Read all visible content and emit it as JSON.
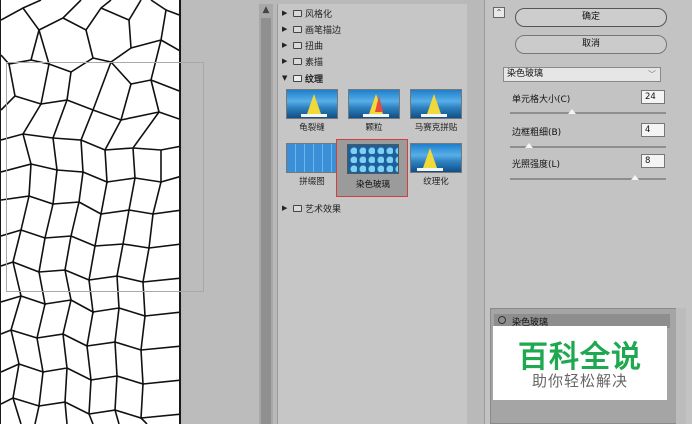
{
  "gallery": {
    "folders_top": [
      {
        "label": "风格化"
      },
      {
        "label": "画笔描边"
      },
      {
        "label": "扭曲"
      },
      {
        "label": "素描"
      }
    ],
    "open_folder": {
      "label": "纹理"
    },
    "thumbnails": [
      {
        "label": "龟裂缝"
      },
      {
        "label": "颗粒"
      },
      {
        "label": "马赛克拼贴"
      },
      {
        "label": "拼缀图"
      },
      {
        "label": "染色玻璃"
      },
      {
        "label": "纹理化"
      }
    ],
    "folders_bottom": [
      {
        "label": "艺术效果"
      }
    ]
  },
  "settings": {
    "collapse_icon": "collapse-up-icon",
    "ok_label": "确定",
    "cancel_label": "取消",
    "filter_selected": "染色玻璃",
    "params": [
      {
        "label": "单元格大小(C)",
        "value": "24",
        "level": 0.4
      },
      {
        "label": "边框粗细(B)",
        "value": "4",
        "level": 0.12
      },
      {
        "label": "光照强度(L)",
        "value": "8",
        "level": 0.8
      }
    ],
    "layer_name": "染色玻璃"
  },
  "watermark": {
    "title": "百科全说",
    "subtitle": "助你轻松解决"
  },
  "colors": {
    "accent_green": "#1ea84f",
    "selection_border": "#d04040"
  }
}
